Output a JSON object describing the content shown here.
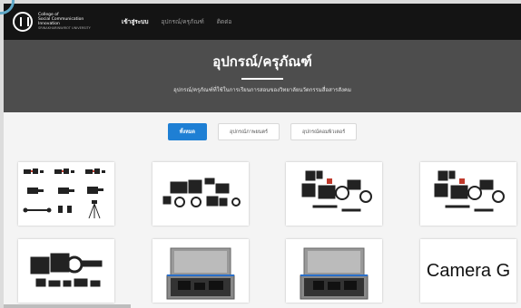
{
  "logo": {
    "line1": "College of",
    "line2": "Social Communication",
    "line3": "Innovation",
    "line4": "SRINAKHARINWIROT UNIVERSITY"
  },
  "nav": {
    "items": [
      {
        "label": "เข้าสู่ระบบ"
      },
      {
        "label": "อุปกรณ์/ครุภัณฑ์"
      },
      {
        "label": "ติดต่อ"
      }
    ]
  },
  "hero": {
    "title": "อุปกรณ์/ครุภัณฑ์",
    "subtitle": "อุปกรณ์/ครุภัณฑ์ที่ใช้ในการเรียนการสอนของวิทยาลัยนวัตกรรมสื่อสารสังคม"
  },
  "filters": [
    {
      "label": "ทั้งหมด"
    },
    {
      "label": "อุปกรณ์ภาพยนตร์"
    },
    {
      "label": "อุปกรณ์คอมพิวเตอร์"
    }
  ],
  "cards": [
    {
      "caption": ""
    },
    {
      "caption": ""
    },
    {
      "caption": ""
    },
    {
      "caption": ""
    },
    {
      "caption": ""
    },
    {
      "caption": ""
    },
    {
      "caption": ""
    },
    {
      "caption": "Camera G"
    }
  ],
  "colors": {
    "nav_bg": "#141414",
    "hero_bg": "#4d4d4d",
    "active_filter": "#1e7fd4"
  }
}
